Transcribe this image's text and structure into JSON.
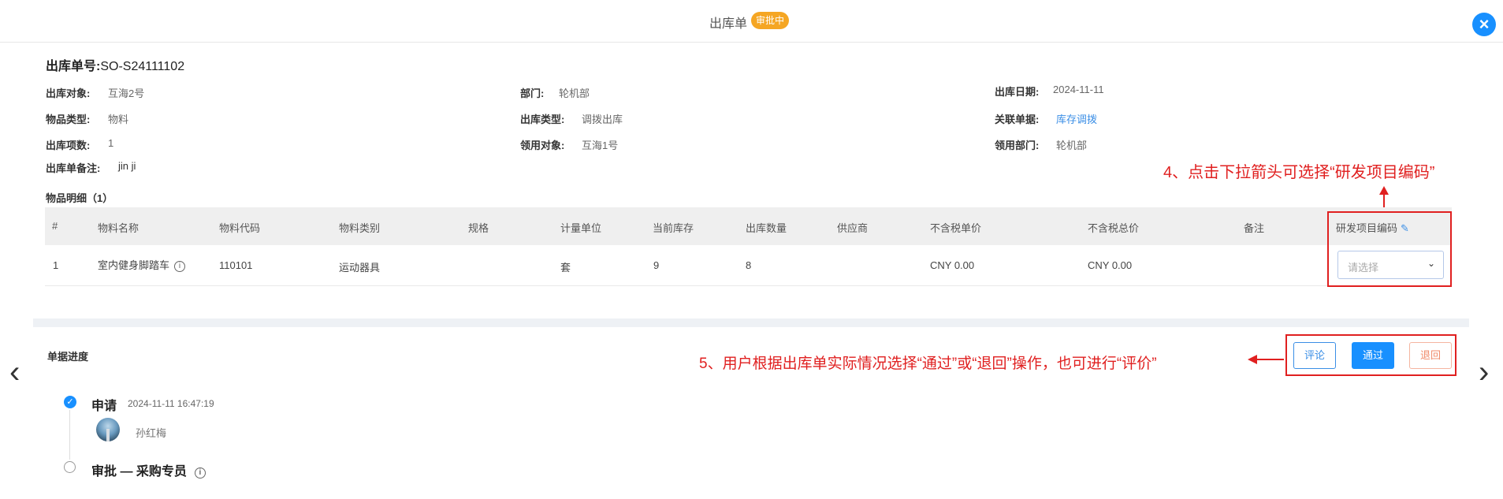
{
  "header": {
    "title": "出库单",
    "status": "审批中",
    "close_icon": "close-icon"
  },
  "order": {
    "label": "出库单号:",
    "value": "SO-S24111102"
  },
  "fields": {
    "target_label": "出库对象:",
    "target_value": "互海2号",
    "dept_label": "部门:",
    "dept_value": "轮机部",
    "date_label": "出库日期:",
    "date_value": "2024-11-11",
    "item_type_label": "物品类型:",
    "item_type_value": "物料",
    "out_type_label": "出库类型:",
    "out_type_value": "调拨出库",
    "related_label": "关联单据:",
    "related_value": "库存调拨",
    "count_label": "出库项数:",
    "count_value": "1",
    "receiver_label": "领用对象:",
    "receiver_value": "互海1号",
    "receiver_dept_label": "领用部门:",
    "receiver_dept_value": "轮机部",
    "remark_label": "出库单备注:",
    "remark_value": "jin ji"
  },
  "details": {
    "title": "物品明细（1）",
    "columns": [
      "#",
      "物料名称",
      "物料代码",
      "物料类别",
      "规格",
      "计量单位",
      "当前库存",
      "出库数量",
      "供应商",
      "不含税单价",
      "不含税总价",
      "备注",
      "研发项目编码"
    ],
    "row": {
      "index": "1",
      "name": "室内健身脚踏车",
      "code": "110101",
      "category": "运动器具",
      "spec": "",
      "unit": "套",
      "stock": "9",
      "qty": "8",
      "supplier": "",
      "unit_price": "CNY 0.00",
      "total_price": "CNY 0.00",
      "remark": ""
    },
    "project_select": {
      "placeholder": "请选择"
    }
  },
  "annotations": {
    "note4": "4、点击下拉箭头可选择“研发项目编码”",
    "note5": "5、用户根据出库单实际情况选择“通过”或“退回”操作，也可进行“评价”"
  },
  "progress": {
    "title": "单据进度",
    "steps": [
      {
        "title": "申请",
        "time": "2024-11-11 16:47:19",
        "user": "孙红梅",
        "done": true
      },
      {
        "title": "审批 — 采购专员",
        "done": false
      }
    ]
  },
  "actions": {
    "comment": "评论",
    "pass": "通过",
    "return": "退回"
  },
  "colors": {
    "accent": "#1890ff",
    "annotation": "#e02020",
    "badge": "#f5a623"
  }
}
